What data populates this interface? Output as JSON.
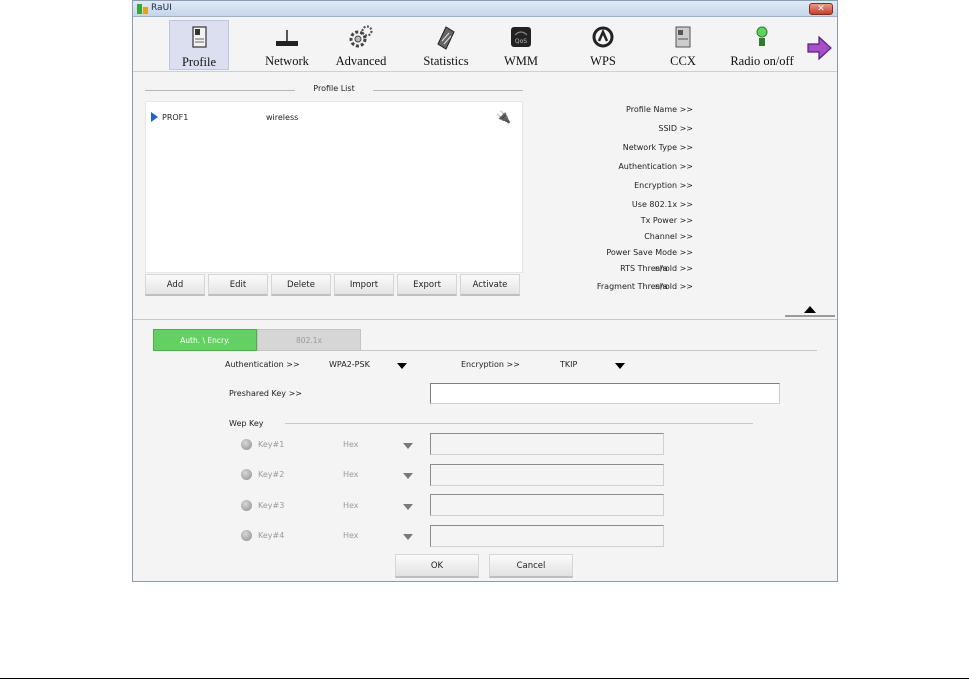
{
  "window": {
    "title": "RaUI",
    "close_label": "✕"
  },
  "toolbar": {
    "items": [
      {
        "label": "Profile",
        "icon": "profile-icon"
      },
      {
        "label": "Network",
        "icon": "network-icon"
      },
      {
        "label": "Advanced",
        "icon": "advanced-gears-icon"
      },
      {
        "label": "Statistics",
        "icon": "statistics-icon"
      },
      {
        "label": "WMM",
        "icon": "wmm-qos-icon"
      },
      {
        "label": "WPS",
        "icon": "wps-icon"
      },
      {
        "label": "CCX",
        "icon": "ccx-icon"
      },
      {
        "label": "Radio on/off",
        "icon": "radio-icon"
      }
    ],
    "next_icon": "purple-arrow-right-icon"
  },
  "profile_list": {
    "heading": "Profile List",
    "rows": [
      {
        "name": "PROF1",
        "ssid": "wireless",
        "status_icon": "plug-icon"
      }
    ],
    "buttons": [
      "Add",
      "Edit",
      "Delete",
      "Import",
      "Export",
      "Activate"
    ]
  },
  "profile_info": {
    "labels": [
      "Profile Name >>",
      "SSID >>",
      "Network Type >>",
      "Authentication >>",
      "Encryption >>",
      "Use 802.1x >>",
      "Tx Power >>",
      "Channel >>",
      "Power Save Mode >>",
      "RTS Threshold >>",
      "Fragment Threshold >>"
    ],
    "rts_value": "n/a",
    "frag_value": "n/a"
  },
  "tabs": {
    "auth": "Auth. \\ Encry.",
    "x8021": "802.1x"
  },
  "auth": {
    "auth_label": "Authentication >>",
    "auth_value": "WPA2-PSK",
    "enc_label": "Encryption >>",
    "enc_value": "TKIP",
    "psk_label": "Preshared Key >>",
    "psk_value": "",
    "wep_heading": "Wep Key",
    "wep_keys": [
      {
        "label": "Key#1",
        "format": "Hex",
        "value": ""
      },
      {
        "label": "Key#2",
        "format": "Hex",
        "value": ""
      },
      {
        "label": "Key#3",
        "format": "Hex",
        "value": ""
      },
      {
        "label": "Key#4",
        "format": "Hex",
        "value": ""
      }
    ]
  },
  "footer": {
    "ok": "OK",
    "cancel": "Cancel"
  }
}
